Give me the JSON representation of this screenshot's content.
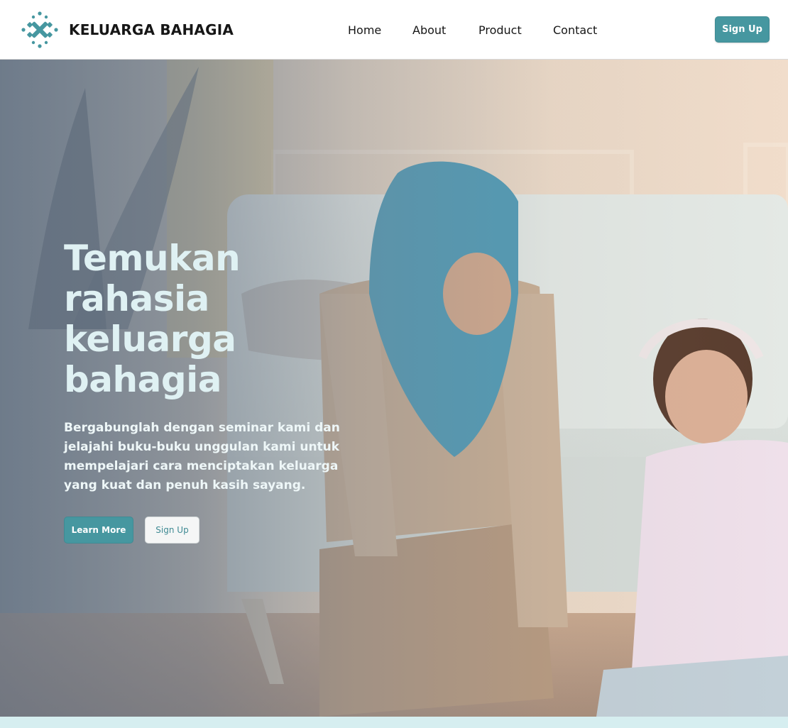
{
  "brand": {
    "name": "KELUARGA BAHAGIA",
    "logo_icon": "cross-x-logo-icon",
    "color": "#4697a0"
  },
  "nav": {
    "items": [
      {
        "label": "Home"
      },
      {
        "label": "About"
      },
      {
        "label": "Product"
      },
      {
        "label": "Contact"
      }
    ],
    "signup_label": "Sign Up"
  },
  "hero": {
    "title": "Temukan rahasia keluarga bahagia",
    "description": "Bergabunglah dengan seminar kami dan jelajahi buku-buku unggulan kami untuk mempelajari cara menciptakan keluarga yang kuat dan penuh kasih sayang.",
    "learn_more_label": "Learn More",
    "signup_label": "Sign Up"
  },
  "colors": {
    "accent": "#4697a0",
    "hero_title": "#dff1f3",
    "strip": "#d6eef0"
  }
}
